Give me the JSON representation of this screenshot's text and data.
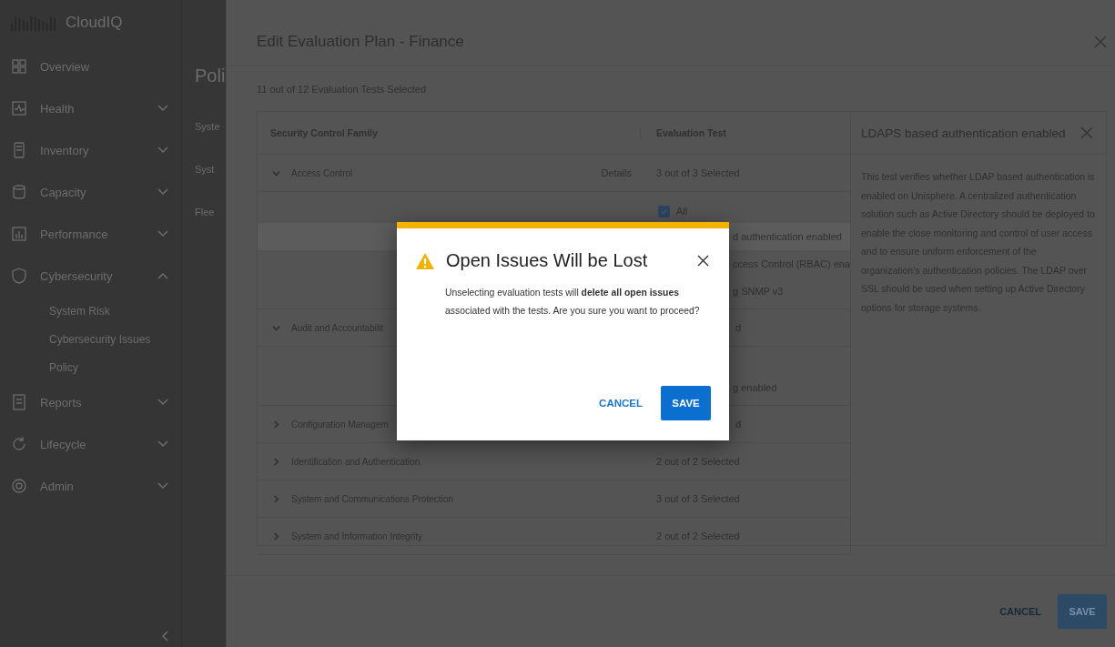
{
  "sidebar": {
    "logo": "CloudIQ",
    "items": [
      {
        "label": "Overview"
      },
      {
        "label": "Health",
        "expanded": false
      },
      {
        "label": "Inventory",
        "expanded": false
      },
      {
        "label": "Capacity",
        "expanded": false
      },
      {
        "label": "Performance",
        "expanded": false
      },
      {
        "label": "Cybersecurity",
        "expanded": true,
        "children": [
          {
            "label": "System Risk"
          },
          {
            "label": "Cybersecurity Issues"
          },
          {
            "label": "Policy"
          }
        ]
      },
      {
        "label": "Reports",
        "expanded": false
      },
      {
        "label": "Lifecycle",
        "expanded": false
      },
      {
        "label": "Admin",
        "expanded": false
      }
    ]
  },
  "background_page": {
    "title": "Poli",
    "texts": [
      "Syste",
      "Syst",
      "Flee"
    ]
  },
  "drawer": {
    "title": "Edit Evaluation Plan - Finance",
    "selection_summary": "11 out of 12 Evaluation Tests Selected",
    "table": {
      "columns": [
        "Security Control Family",
        "Evaluation Test"
      ],
      "rows": [
        {
          "family": "Access Control",
          "expanded": true,
          "details_link": "Details",
          "evaluation": "3 out of 3 Selected",
          "all_label": "All",
          "all_checked": true,
          "tests": [
            {
              "label": "d authentication enabled",
              "selected": true
            },
            {
              "label": "ccess Control (RBAC) ena",
              "selected": false
            },
            {
              "label": "g SNMP v3",
              "selected": false
            }
          ]
        },
        {
          "family": "Audit and Accountabilit",
          "expanded": true,
          "evaluation": "d",
          "tests": [
            {
              "label": "g enabled",
              "selected": false
            }
          ]
        },
        {
          "family": "Configuration Managem",
          "expanded": false,
          "evaluation": "d"
        },
        {
          "family": "Identification and Authentication",
          "expanded": false,
          "evaluation": "2 out of 2 Selected"
        },
        {
          "family": "System and Communications Protection",
          "expanded": false,
          "evaluation": "3 out of 3 Selected"
        },
        {
          "family": "System and Information Integrity",
          "expanded": false,
          "evaluation": "2 out of 2 Selected"
        }
      ]
    },
    "details_panel": {
      "title": "LDAPS based authentication enabled",
      "text": "This test verifies whether LDAP based authentication is enabled on Unisphere. A centralized authentication solution such as Active Directory should be deployed to enable the close monitoring and control of user access and to ensure uniform enforcement of the organization’s authentication policies. The LDAP over SSL should be used when setting up Active Directory options for storage systems."
    },
    "footer": {
      "cancel": "CANCEL",
      "save": "SAVE"
    }
  },
  "dialog": {
    "title": "Open Issues Will be Lost",
    "body": "Unselecting evaluation tests will **delete all open issues** associated with the tests. Are you sure you want to proceed?",
    "cancel": "CANCEL",
    "save": "SAVE"
  }
}
